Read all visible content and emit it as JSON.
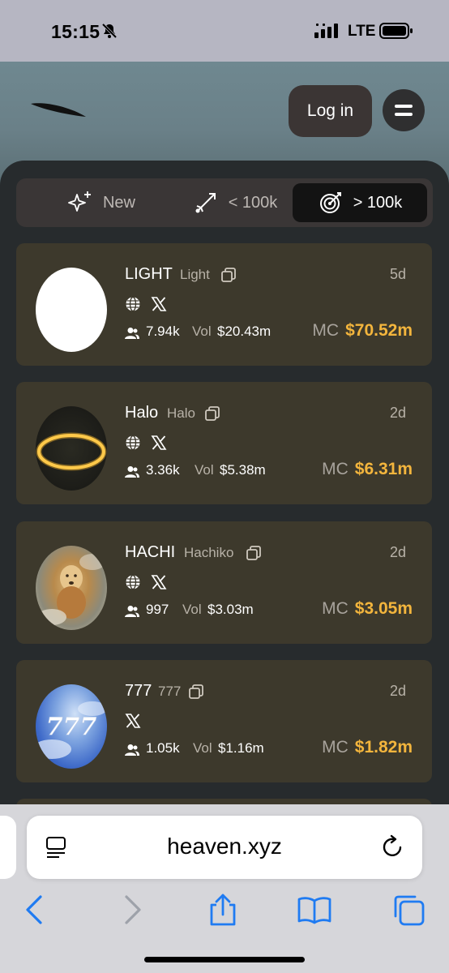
{
  "status": {
    "time": "15:15",
    "network": "LTE"
  },
  "header": {
    "login_label": "Log in"
  },
  "tabs": [
    {
      "label": "New",
      "icon": "sparkle-icon"
    },
    {
      "label": "< 100k",
      "icon": "rocket-trail-icon"
    },
    {
      "label": "> 100k",
      "icon": "target-icon",
      "active": true
    }
  ],
  "tokens": [
    {
      "symbol": "LIGHT",
      "name": "Light",
      "age": "5d",
      "holders": "7.94k",
      "vol_label": "Vol",
      "vol": "$20.43m",
      "mc_label": "MC",
      "mc": "$70.52m",
      "links": [
        "globe-icon",
        "x-icon"
      ]
    },
    {
      "symbol": "Halo",
      "name": "Halo",
      "age": "2d",
      "holders": "3.36k",
      "vol_label": "Vol",
      "vol": "$5.38m",
      "mc_label": "MC",
      "mc": "$6.31m",
      "links": [
        "globe-icon",
        "x-icon"
      ]
    },
    {
      "symbol": "HACHI",
      "name": "Hachiko",
      "age": "2d",
      "holders": "997",
      "vol_label": "Vol",
      "vol": "$3.03m",
      "mc_label": "MC",
      "mc": "$3.05m",
      "links": [
        "globe-icon",
        "x-icon"
      ]
    },
    {
      "symbol": "777",
      "name": "777",
      "age": "2d",
      "holders": "1.05k",
      "vol_label": "Vol",
      "vol": "$1.16m",
      "mc_label": "MC",
      "mc": "$1.82m",
      "links": [
        "x-icon"
      ],
      "avatar_text": "777"
    }
  ],
  "browser": {
    "url": "heaven.xyz"
  },
  "colors": {
    "accent": "#f3b53d",
    "card": "#3d392c",
    "panel": "#272b2d"
  }
}
